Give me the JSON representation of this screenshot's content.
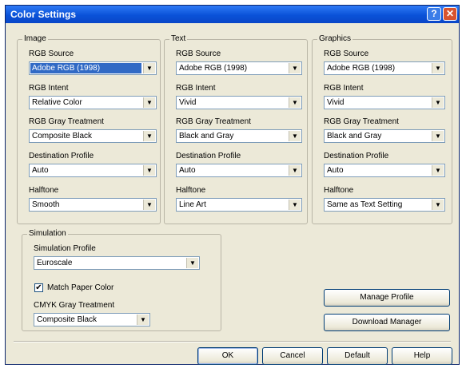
{
  "window": {
    "title": "Color Settings",
    "help_glyph": "?",
    "close_glyph": "✕"
  },
  "image": {
    "label": "Image",
    "rgb_source_label": "RGB Source",
    "rgb_source_value": "Adobe RGB (1998)",
    "rgb_intent_label": "RGB Intent",
    "rgb_intent_value": "Relative Color",
    "rgb_gray_label": "RGB Gray Treatment",
    "rgb_gray_value": "Composite Black",
    "dest_profile_label": "Destination Profile",
    "dest_profile_value": "Auto",
    "halftone_label": "Halftone",
    "halftone_value": "Smooth"
  },
  "text": {
    "label": "Text",
    "rgb_source_label": "RGB Source",
    "rgb_source_value": "Adobe RGB (1998)",
    "rgb_intent_label": "RGB Intent",
    "rgb_intent_value": "Vivid",
    "rgb_gray_label": "RGB Gray Treatment",
    "rgb_gray_value": "Black and Gray",
    "dest_profile_label": "Destination Profile",
    "dest_profile_value": "Auto",
    "halftone_label": "Halftone",
    "halftone_value": "Line Art"
  },
  "graphics": {
    "label": "Graphics",
    "rgb_source_label": "RGB Source",
    "rgb_source_value": "Adobe RGB (1998)",
    "rgb_intent_label": "RGB Intent",
    "rgb_intent_value": "Vivid",
    "rgb_gray_label": "RGB Gray Treatment",
    "rgb_gray_value": "Black and Gray",
    "dest_profile_label": "Destination Profile",
    "dest_profile_value": "Auto",
    "halftone_label": "Halftone",
    "halftone_value": "Same as Text Setting"
  },
  "simulation": {
    "label": "Simulation",
    "profile_label": "Simulation Profile",
    "profile_value": "Euroscale",
    "match_paper_label": "Match Paper Color",
    "match_paper_checked": "✔",
    "cmyk_gray_label": "CMYK Gray Treatment",
    "cmyk_gray_value": "Composite Black"
  },
  "side_buttons": {
    "manage_profile": "Manage Profile",
    "download_manager": "Download Manager"
  },
  "footer": {
    "ok": "OK",
    "cancel": "Cancel",
    "default": "Default",
    "help": "Help"
  },
  "icons": {
    "dropdown_arrow": "▼"
  }
}
